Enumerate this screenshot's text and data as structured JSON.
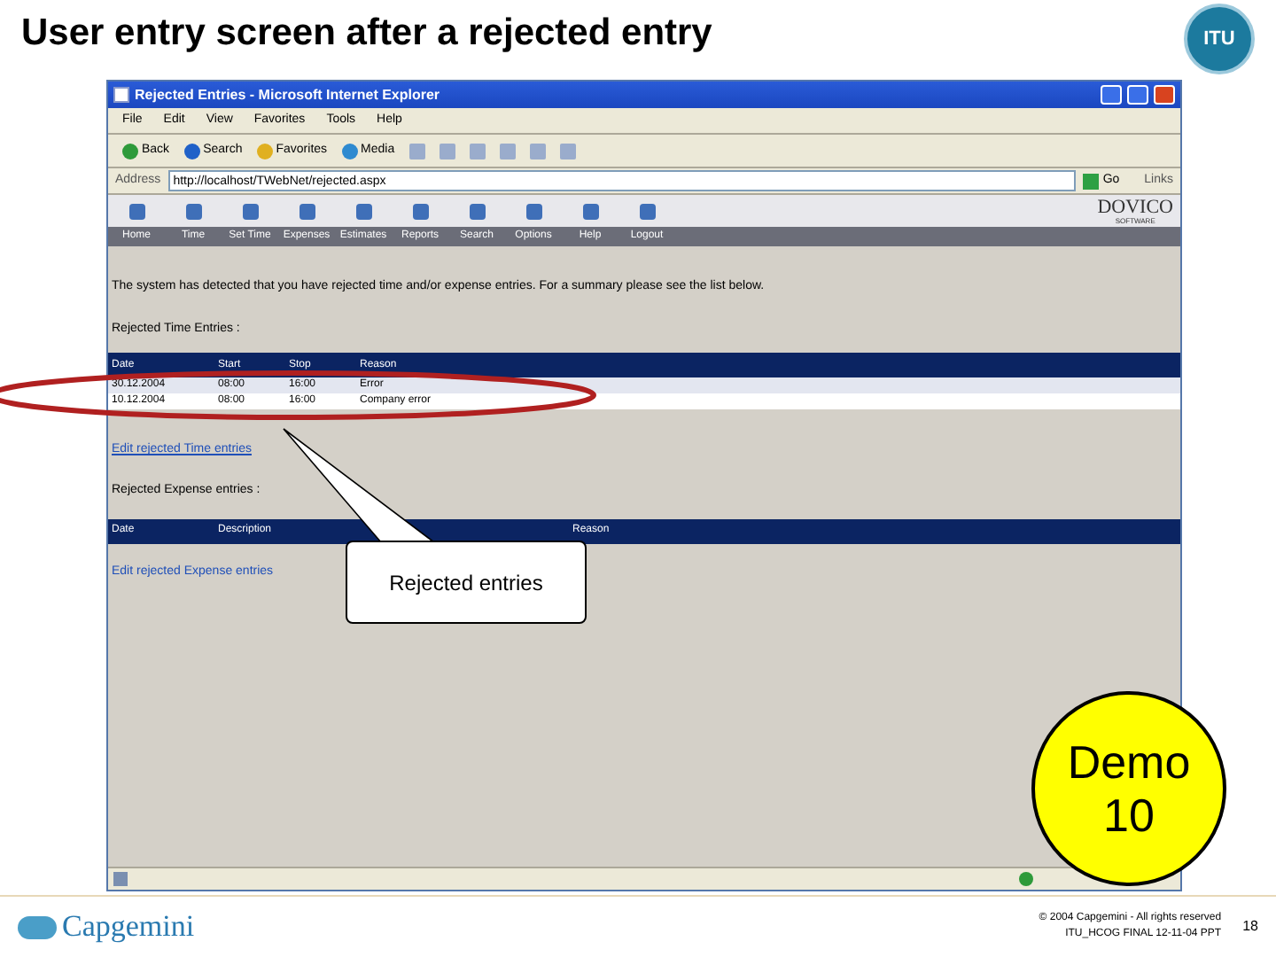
{
  "slide": {
    "title": "User entry screen after a rejected entry",
    "emblem_text": "ITU"
  },
  "browser": {
    "title": "Rejected Entries - Microsoft Internet Explorer",
    "menu": [
      "File",
      "Edit",
      "View",
      "Favorites",
      "Tools",
      "Help"
    ],
    "toolbar": [
      "Back",
      "Search",
      "Favorites",
      "Media"
    ],
    "address_label": "Address",
    "address": "http://localhost/TWebNet/rejected.aspx",
    "go": "Go",
    "links": "Links"
  },
  "app": {
    "brand": "DOVICO",
    "brand_sub": "SOFTWARE",
    "nav": [
      "Home",
      "Time",
      "Set Time",
      "Expenses",
      "Estimates",
      "Reports",
      "Search",
      "Options",
      "Help",
      "Logout"
    ],
    "message": "The system has detected that you have rejected time and/or expense entries. For a summary please see the list below.",
    "time_section": {
      "heading": "Rejected Time Entries :",
      "columns": [
        "Date",
        "Start",
        "Stop",
        "Reason"
      ],
      "rows": [
        [
          "30.12.2004",
          "08:00",
          "16:00",
          "Error"
        ],
        [
          "10.12.2004",
          "08:00",
          "16:00",
          "Company error"
        ]
      ],
      "link": "Edit rejected Time entries"
    },
    "expense_section": {
      "heading": "Rejected Expense entries :",
      "columns": [
        "Date",
        "Description",
        "Reason"
      ],
      "link": "Edit rejected Expense entries"
    }
  },
  "callout": "Rejected entries",
  "demo": [
    "Demo",
    "10"
  ],
  "footer": {
    "brand": "Capgemini",
    "copyright": "© 2004 Capgemini - All rights reserved",
    "file": "ITU_HCOG FINAL 12-11-04 PPT",
    "page": "18"
  }
}
